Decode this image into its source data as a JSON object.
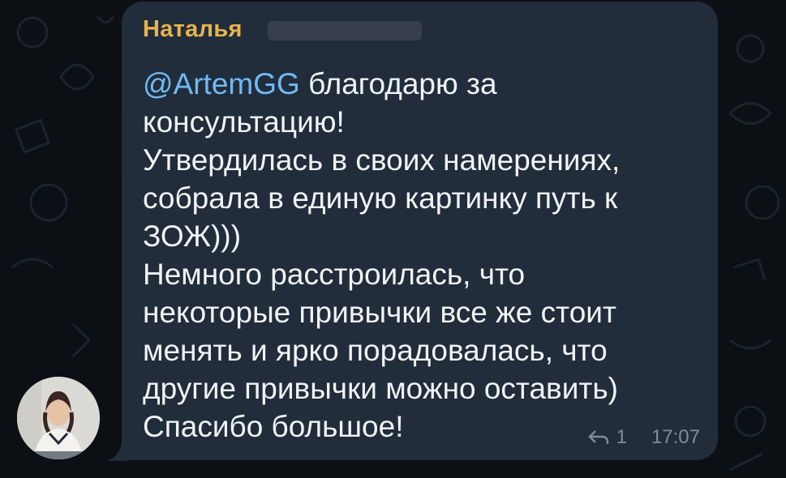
{
  "message": {
    "sender_name": "Наталья",
    "mention": "@ArtemGG",
    "text_after_mention": " благодарю за\nконсультацию!\nУтвердилась в своих намерениях,\nсобрала в единую картинку путь к\nЗОЖ)))\nНемного расстроилась, что\nнекоторые привычки все же стоит\nменять и ярко порадовалась, что\nдругие привычки можно оставить)\nСпасибо большое!",
    "reply_count": "1",
    "time": "17:07",
    "reply_icon": "reply-arrow-icon"
  },
  "colors": {
    "bubble": "#212d3b",
    "sender_name": "#e8b24d",
    "mention": "#71b9f4",
    "text": "#f1f3f5",
    "meta": "#7e8b99",
    "background": "#0c0f13"
  }
}
